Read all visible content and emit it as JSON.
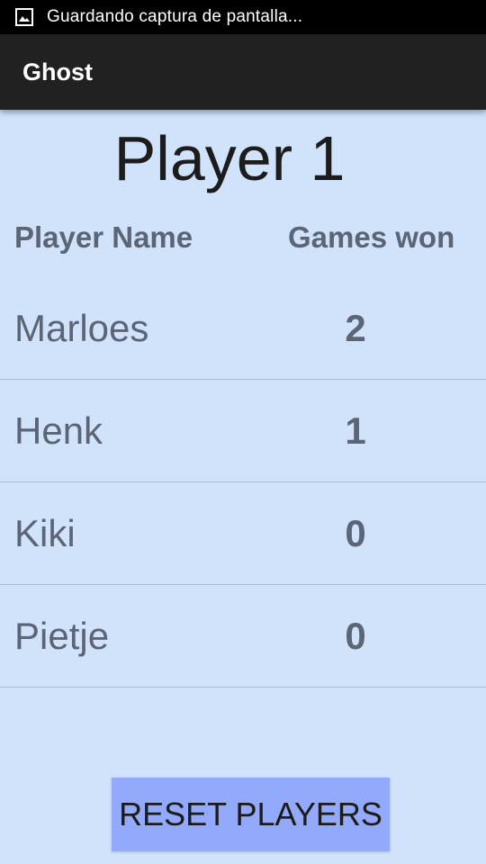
{
  "status_bar": {
    "icon": "image-icon",
    "text": "Guardando captura de pantalla..."
  },
  "app_bar": {
    "title": "Ghost"
  },
  "main": {
    "player_title": "Player 1",
    "table": {
      "headers": [
        "Player Name",
        "Games won"
      ],
      "rows": [
        {
          "name": "Marloes",
          "games_won": "2"
        },
        {
          "name": "Henk",
          "games_won": "1"
        },
        {
          "name": "Kiki",
          "games_won": "0"
        },
        {
          "name": "Pietje",
          "games_won": "0"
        }
      ]
    },
    "reset_button_label": "RESET PLAYERS"
  },
  "colors": {
    "background": "#d0e3fb",
    "app_bar": "#212121",
    "status_bar": "#000000",
    "button": "#93a9fb",
    "muted_text": "#5b6576"
  }
}
